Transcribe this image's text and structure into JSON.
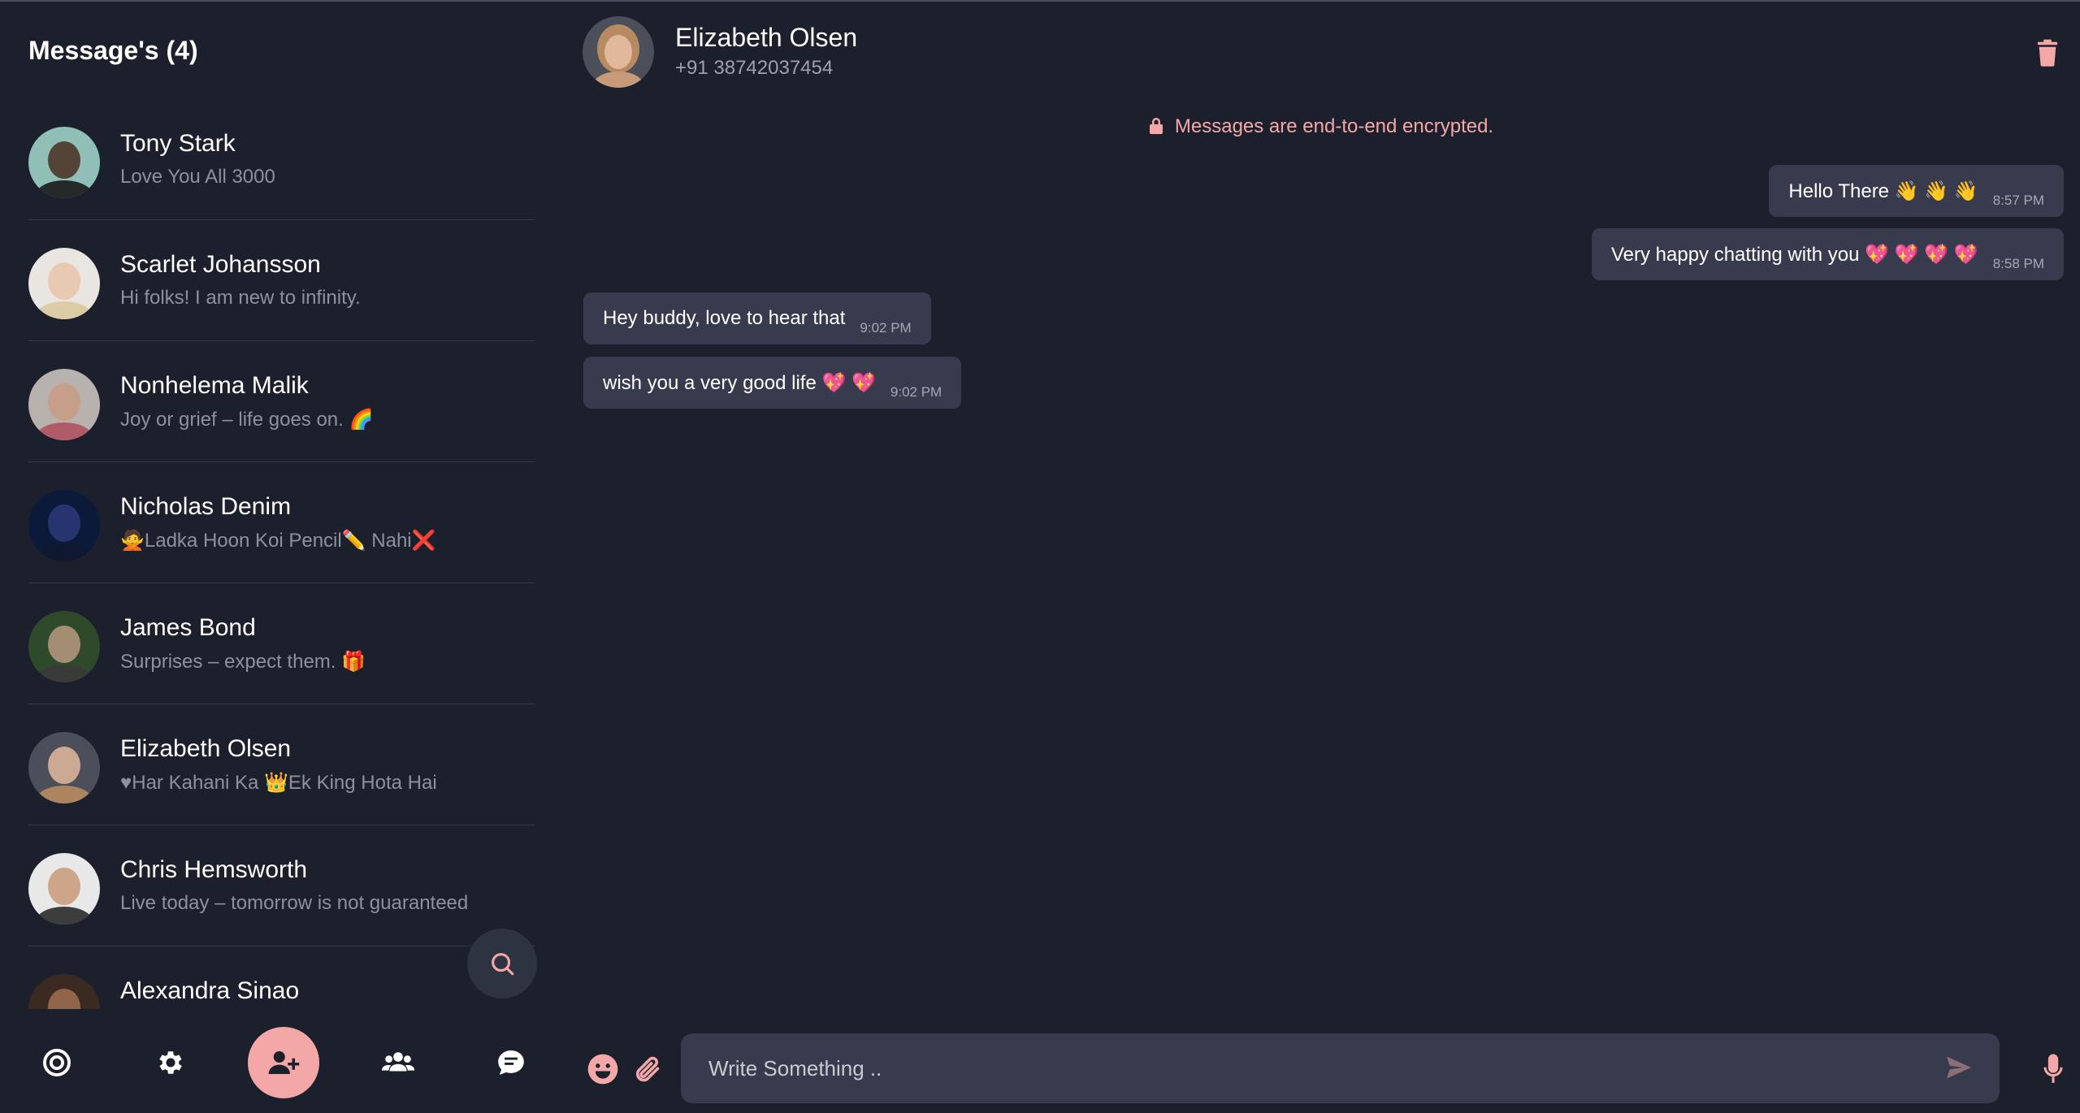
{
  "sidebar": {
    "title": "Message's (4)",
    "contacts": [
      {
        "name": "Tony Stark",
        "message": "Love You All 3000",
        "avatar_bg": "#8fbfb6",
        "skin": "#4a2e22",
        "cloth": "#1a1a1a"
      },
      {
        "name": "Scarlet Johansson",
        "message": "Hi folks! I am new to infinity.",
        "avatar_bg": "#e9e5e1",
        "skin": "#e8c4a8",
        "cloth": "#d9c9a0"
      },
      {
        "name": "Nonhelema Malik",
        "message": "Joy or grief – life goes on. 🌈",
        "avatar_bg": "#b8b2ae",
        "skin": "#c99a82",
        "cloth": "#b05060"
      },
      {
        "name": "Nicholas Denim",
        "message": "🙅Ladka Hoon Koi Pencil✏️ Nahi❌",
        "avatar_bg": "#0c1a3a",
        "skin": "#2b3b7a",
        "cloth": "#101830"
      },
      {
        "name": "James Bond",
        "message": "Surprises – expect them. 🎁",
        "avatar_bg": "#2f4a2a",
        "skin": "#b89a80",
        "cloth": "#3a3a3a"
      },
      {
        "name": "Elizabeth Olsen",
        "message": "♥Har Kahani Ka 👑Ek King Hota Hai",
        "avatar_bg": "#4a4f5a",
        "skin": "#e2b89c",
        "cloth": "#b88a60"
      },
      {
        "name": "Chris Hemsworth",
        "message": "Live today – tomorrow is not guaranteed.",
        "avatar_bg": "#e8e8e8",
        "skin": "#c89a78",
        "cloth": "#2a2a2a"
      },
      {
        "name": "Alexandra Sinao",
        "message": "",
        "avatar_bg": "#3a2a22",
        "skin": "#a07050",
        "cloth": "#2a1a14"
      }
    ],
    "nav": [
      "status-icon",
      "settings-icon",
      "add-user-icon",
      "groups-icon",
      "chats-icon"
    ]
  },
  "chat": {
    "contact_name": "Elizabeth Olsen",
    "contact_phone": "+91 38742037454",
    "encryption_note": "Messages are end-to-end encrypted.",
    "messages": [
      {
        "text": "Hello There 👋 👋 👋",
        "time": "8:57 PM",
        "side": "sent"
      },
      {
        "text": "Very happy chatting with you 💖 💖 💖 💖",
        "time": "8:58 PM",
        "side": "sent"
      },
      {
        "text": "Hey buddy, love to hear that",
        "time": "9:02 PM",
        "side": "received"
      },
      {
        "text": "wish you a very good life 💖 💖",
        "time": "9:02 PM",
        "side": "received"
      }
    ],
    "composer_placeholder": "Write Something .."
  },
  "colors": {
    "background": "#1c202c",
    "bubble": "#373b4d",
    "accent": "#f4a7a7"
  }
}
